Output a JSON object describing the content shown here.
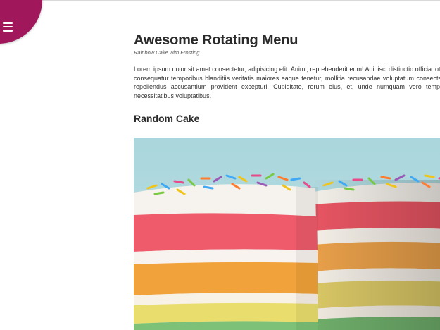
{
  "menu": {
    "toggle_icon": "hamburger-icon",
    "accent_color": "#a0175c"
  },
  "article": {
    "title": "Awesome Rotating Menu",
    "subtitle": "Rainbow Cake with Frosting",
    "paragraph": "Lorem ipsum dolor sit amet consectetur, adipisicing elit. Animi, reprehenderit eum! Adipisci distinctio officia totam consequatur temporibus blanditiis veritatis maiores eaque tenetur, mollitia recusandae voluptatum consectetur repellendus accusantium provident excepturi. Cupiditate, rerum eius, et, unde numquam vero tempora necessitatibus voluptatibus.",
    "section_heading": "Random Cake",
    "image_subject": "rainbow-layer-cake-photo"
  }
}
